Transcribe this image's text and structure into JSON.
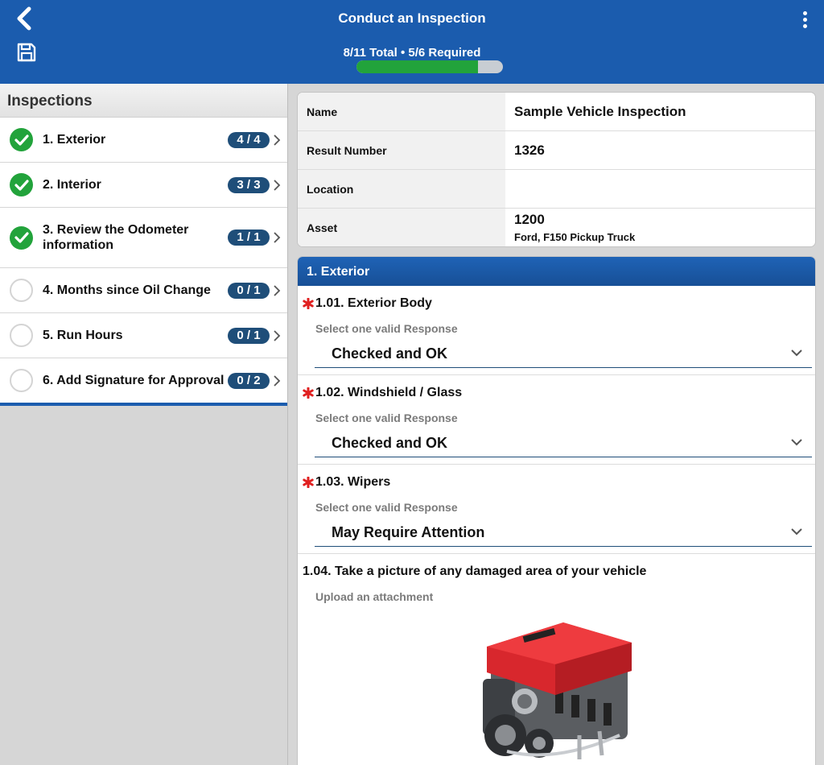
{
  "header": {
    "title": "Conduct an Inspection",
    "progress_text": "8/11 Total • 5/6 Required",
    "progress_fraction": 0.83,
    "accent_color": "#1b5cae",
    "progress_color": "#22a33b"
  },
  "sidebar": {
    "heading": "Inspections",
    "items": [
      {
        "label": "1. Exterior",
        "badge": "4 / 4",
        "status": "complete"
      },
      {
        "label": "2. Interior",
        "badge": "3 / 3",
        "status": "complete"
      },
      {
        "label": "3. Review the Odometer information",
        "badge": "1 / 1",
        "status": "complete"
      },
      {
        "label": "4. Months since Oil Change",
        "badge": "0 / 1",
        "status": "incomplete"
      },
      {
        "label": "5. Run Hours",
        "badge": "0 / 1",
        "status": "incomplete"
      },
      {
        "label": "6. Add Signature for Approval",
        "badge": "0 / 2",
        "status": "incomplete"
      }
    ]
  },
  "info": {
    "name_label": "Name",
    "name_value": "Sample Vehicle Inspection",
    "result_label": "Result Number",
    "result_value": "1326",
    "location_label": "Location",
    "location_value": "",
    "asset_label": "Asset",
    "asset_value": "1200",
    "asset_detail": "Ford, F150 Pickup Truck"
  },
  "section": {
    "title": "1. Exterior",
    "questions": [
      {
        "title": "1.01. Exterior Body",
        "hint": "Select one valid Response",
        "value": "Checked and OK",
        "required": true
      },
      {
        "title": "1.02. Windshield / Glass",
        "hint": "Select one valid Response",
        "value": "Checked and OK",
        "required": true
      },
      {
        "title": "1.03. Wipers",
        "hint": "Select one valid Response",
        "value": "May Require Attention",
        "required": true
      },
      {
        "title": "1.04. Take a picture of any damaged area of your vehicle",
        "hint": "Upload an attachment",
        "required": false
      }
    ]
  },
  "icons": {
    "back": "chevron-left-icon",
    "save": "floppy-disk-icon",
    "menu": "kebab-menu-icon",
    "complete": "check-circle-icon",
    "incomplete": "empty-circle-icon",
    "required": "asterisk-icon",
    "dropdown": "chevron-down-icon"
  }
}
